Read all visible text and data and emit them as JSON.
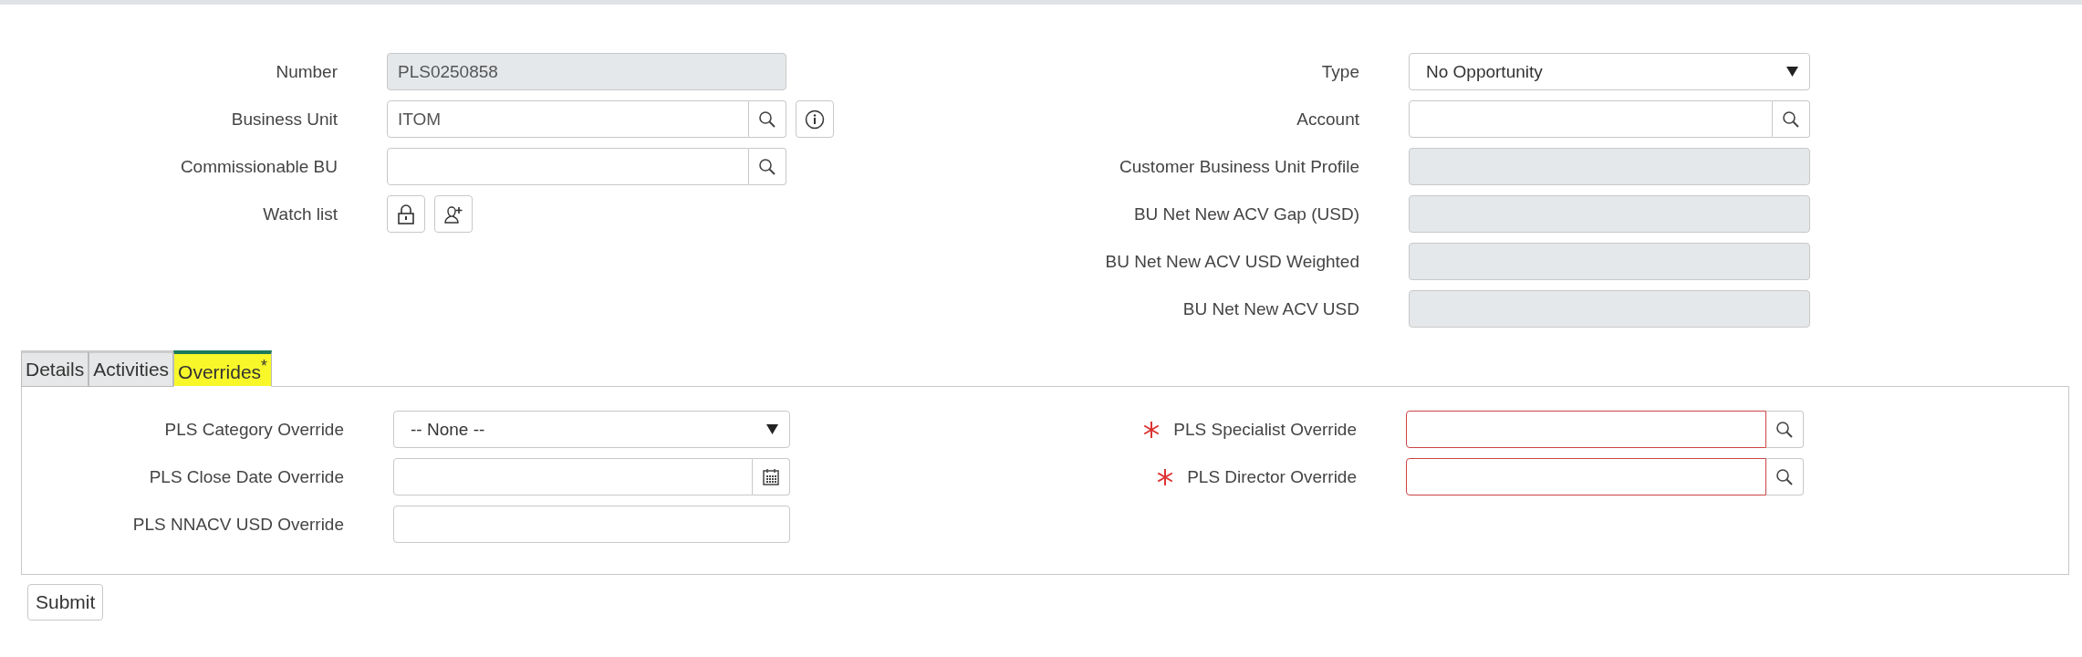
{
  "header_fields": {
    "left": [
      {
        "label": "Number",
        "kind": "readonly",
        "value": "PLS0250858"
      },
      {
        "label": "Business Unit",
        "kind": "lookup",
        "value": "ITOM",
        "info": true
      },
      {
        "label": "Commissionable BU",
        "kind": "lookup"
      },
      {
        "label": "Watch list",
        "kind": "watchlist"
      }
    ],
    "right": [
      {
        "label": "Type",
        "kind": "select",
        "value": "No Opportunity"
      },
      {
        "label": "Account",
        "kind": "lookup"
      },
      {
        "label": "Customer Business Unit Profile",
        "kind": "readonly"
      },
      {
        "label": "BU Net New ACV Gap (USD)",
        "kind": "readonly"
      },
      {
        "label": "BU Net New ACV USD Weighted",
        "kind": "readonly"
      },
      {
        "label": "BU Net New ACV USD",
        "kind": "readonly"
      }
    ]
  },
  "tabs": [
    {
      "label": "Details",
      "selected": false,
      "highlighted": false
    },
    {
      "label": "Activities",
      "selected": false,
      "highlighted": false
    },
    {
      "label": "Overrides$^{*}$",
      "selected": true,
      "highlighted": true
    }
  ],
  "tab_panel": {
    "left": [
      {
        "label": "PLS Category Override",
        "kind": "select",
        "value": "-- None --",
        "required": false
      },
      {
        "label": "PLS Close Date Override",
        "kind": "date",
        "required": false
      },
      {
        "label": "PLS NNACV USD Override",
        "kind": "text",
        "required": false
      }
    ],
    "right": [
      {
        "label": "PLS Specialist Override",
        "kind": "lookup",
        "required": true
      },
      {
        "label": "PLS Director Override",
        "kind": "lookup",
        "required": true
      }
    ]
  },
  "buttons": [
    {
      "label": "Submit"
    }
  ]
}
